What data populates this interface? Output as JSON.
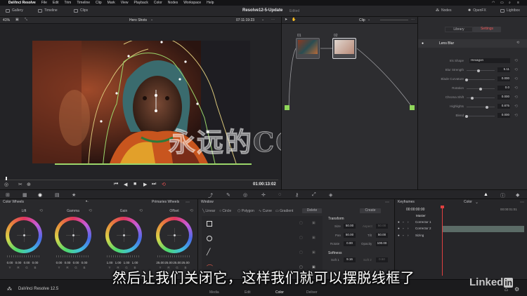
{
  "menubar": {
    "app": "DaVinci Resolve",
    "items": [
      "File",
      "Edit",
      "Trim",
      "Timeline",
      "Clip",
      "Mark",
      "View",
      "Playback",
      "Color",
      "Nodes",
      "Workspace",
      "Help"
    ]
  },
  "top_tabs": {
    "gallery": "Gallery",
    "timeline": "Timeline",
    "clips": "Clips",
    "project": "Resolve12-5-Update",
    "status": "Edited",
    "nodes": "Nodes",
    "openfx": "OpenFX",
    "lightbox": "Lightbox"
  },
  "viewer": {
    "zoom": "41%",
    "clip_name": "Hero Shots",
    "timecode_top": "07:11:19:23",
    "timecode": "01:00:13:02"
  },
  "nodes": {
    "mode": "Clip",
    "node1_label": "01",
    "node2_label": "02"
  },
  "inspector": {
    "library_tab": "Library",
    "settings_tab": "Settings",
    "effect_name": "Lens Blur",
    "params": [
      {
        "name": "Iris Shape",
        "value": "Hexagon"
      },
      {
        "name": "Blur Strength",
        "value": "5.11",
        "level": 0.42
      },
      {
        "name": "Blade Curvature",
        "value": "0.000",
        "level": 0.0
      },
      {
        "name": "Rotation",
        "value": "0.0",
        "level": 0.5
      },
      {
        "name": "Chroma Shift",
        "value": "0.000",
        "level": 0.2
      },
      {
        "name": "Highlights",
        "value": "0.875",
        "level": 0.72
      },
      {
        "name": "Blend",
        "value": "0.000",
        "level": 0.0
      }
    ]
  },
  "color_wheels": {
    "title": "Color Wheels",
    "mode": "Primaries Wheels",
    "wheels": [
      {
        "name": "Lift",
        "values": [
          "0.00",
          "0.00",
          "0.00",
          "0.00"
        ]
      },
      {
        "name": "Gamma",
        "values": [
          "0.00",
          "0.00",
          "0.00",
          "0.00"
        ]
      },
      {
        "name": "Gain",
        "values": [
          "1.00",
          "1.00",
          "1.00",
          "1.00"
        ]
      },
      {
        "name": "Offset",
        "values": [
          "25.00",
          "25.00",
          "25.00",
          "25.00"
        ]
      }
    ],
    "channels": [
      "Y",
      "R",
      "G",
      "B"
    ]
  },
  "window_panel": {
    "title": "Window",
    "shapes": [
      "Linear",
      "Circle",
      "Polygon",
      "Curve",
      "Gradient"
    ],
    "delete": "Delete",
    "create": "Create",
    "transform_title": "Transform",
    "size_label": "Size",
    "size_value": "50.00",
    "aspect_label": "Aspect",
    "aspect_value": "50.00",
    "pan_label": "Pan",
    "pan_value": "50.00",
    "tilt_label": "Tilt",
    "tilt_value": "50.00",
    "rotate_label": "Rotate",
    "rotate_value": "0.00",
    "opacity_label": "Opacity",
    "opacity_value": "100.00",
    "softness_title": "Softness",
    "soft1_label": "Soft 1",
    "soft1_value": "9.16",
    "soft2_label": "Soft 2",
    "soft2_value": "0.50"
  },
  "keyframes": {
    "title": "Keyframes",
    "mode": "Color",
    "time_start": "00:00:00:00",
    "time_end": "00:00:01:01",
    "master": "Master",
    "rows": [
      "Corrector 1",
      "Corrector 2",
      "Sizing"
    ]
  },
  "pages": [
    "Media",
    "Edit",
    "Color",
    "Deliver"
  ],
  "footer_app": "DaVinci Resolve 12.5",
  "subtitle": "然后让我们关闭它，这样我们就可以摆脱线框了",
  "watermark": "永远的CG",
  "linkedin": "Linked"
}
